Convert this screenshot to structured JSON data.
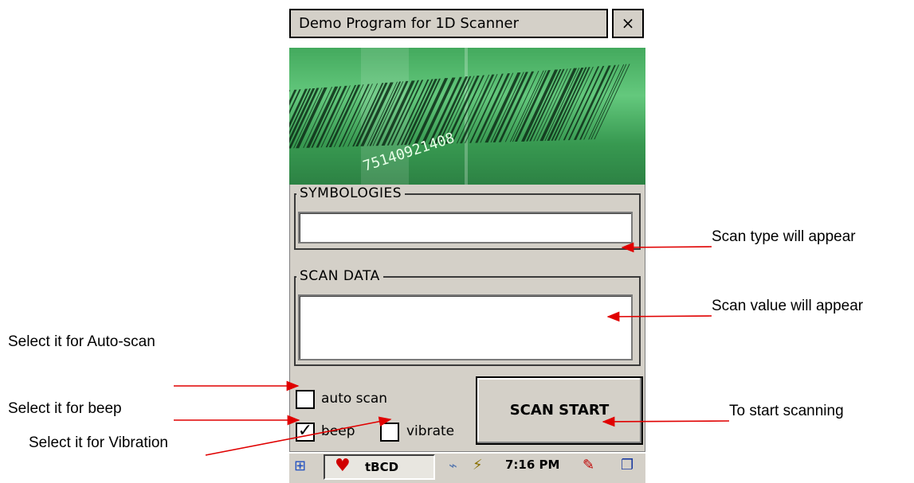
{
  "window": {
    "title": "Demo Program for 1D Scanner",
    "close_label": "×"
  },
  "banner": {
    "alt": "barcode image",
    "digits": "75140921408"
  },
  "symbologies": {
    "group_label": "SYMBOLOGIES",
    "value": ""
  },
  "scan_data": {
    "group_label": "SCAN DATA",
    "value": ""
  },
  "options": {
    "auto_scan": {
      "label": "auto scan",
      "checked": false
    },
    "beep": {
      "label": "beep",
      "checked": true
    },
    "vibrate": {
      "label": "vibrate",
      "checked": false
    }
  },
  "scan_button": {
    "label": "SCAN START"
  },
  "taskbar": {
    "app_label": "tBCD",
    "time": "7:16 PM",
    "icons": [
      "start-windows-icon",
      "app-heart-icon",
      "network-icon",
      "power-plug-icon",
      "keyboard-pen-icon",
      "window-switch-icon"
    ]
  },
  "annotations": {
    "scan_type": "Scan type will appear",
    "scan_value": "Scan value will appear",
    "auto_scan": "Select it for Auto-scan",
    "beep": "Select it for beep",
    "vibration": "Select it for Vibration",
    "start": "To start scanning"
  },
  "colors": {
    "window_bg": "#d4d0c8",
    "banner_green": "#3fa35a",
    "arrow_red": "#e00000"
  }
}
